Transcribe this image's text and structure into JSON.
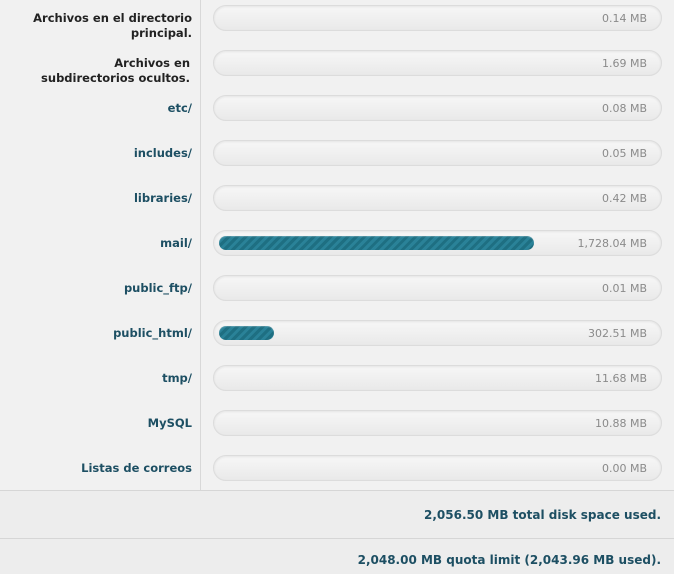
{
  "rows": [
    {
      "label": "Archivos en el directorio principal.",
      "value": "0.14 MB",
      "fill": 0
    },
    {
      "label": "Archivos en subdirectorios ocultos.",
      "value": "1.69 MB",
      "fill": 0
    },
    {
      "label": "etc/",
      "value": "0.08 MB",
      "fill": 0
    },
    {
      "label": "includes/",
      "value": "0.05 MB",
      "fill": 0
    },
    {
      "label": "libraries/",
      "value": "0.42 MB",
      "fill": 0
    },
    {
      "label": "mail/",
      "value": "1,728.04 MB",
      "fill": 0.844
    },
    {
      "label": "public_ftp/",
      "value": "0.01 MB",
      "fill": 0
    },
    {
      "label": "public_html/",
      "value": "302.51 MB",
      "fill": 0.148
    },
    {
      "label": "tmp/",
      "value": "11.68 MB",
      "fill": 0
    },
    {
      "label": "MySQL",
      "value": "10.88 MB",
      "fill": 0
    },
    {
      "label": "Listas de correos",
      "value": "0.00 MB",
      "fill": 0
    }
  ],
  "summary": {
    "total": "2,056.50 MB total disk space used.",
    "quota": "2,048.00 MB quota limit (2,043.96 MB used)."
  },
  "colors": {
    "bar_fill": "#1e6f82",
    "label_text": "#1d4f63"
  }
}
